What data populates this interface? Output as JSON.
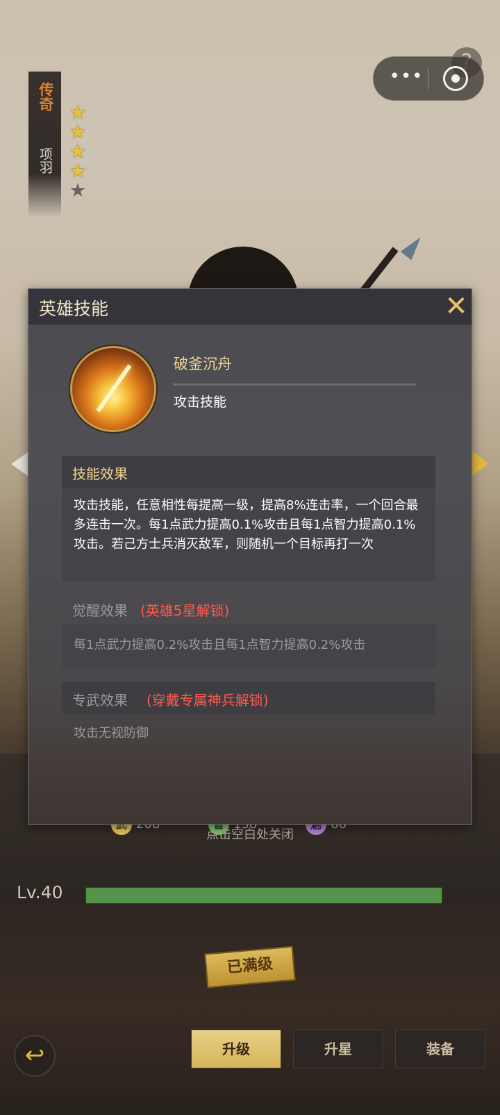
{
  "hero": {
    "rarity": "传奇",
    "name": "项羽",
    "stars_total": 5,
    "stars_filled": 4
  },
  "top_capsule": {
    "more_icon": "more-dots-icon",
    "record_icon": "target-icon",
    "help_icon": "?"
  },
  "modal": {
    "title": "英雄技能",
    "close_icon": "✕",
    "skill": {
      "name": "破釜沉舟",
      "type": "攻击技能"
    },
    "effect": {
      "label": "技能效果",
      "text": "攻击技能，任意相性每提高一级，提高8%连击率，一个回合最多连击一次。每1点武力提高0.1%攻击且每1点智力提高0.1%攻击。若己方士兵消灭敌军，则随机一个目标再打一次"
    },
    "awaken": {
      "label": "觉醒效果",
      "lock_text": "(英雄5星解锁)",
      "text": "每1点武力提高0.2%攻击且每1点智力提高0.2%攻击"
    },
    "exclusive": {
      "label": "专武效果",
      "lock_text": "(穿戴专属神兵解锁)",
      "text": "攻击无视防御"
    }
  },
  "stats": {
    "wu_badge": "武",
    "wu_value": "208",
    "zhi_badge": "智",
    "zhi_value": "158",
    "mei_badge": "魅",
    "mei_value": "66"
  },
  "close_hint": "点击空白处关闭",
  "level": {
    "label": "Lv.40",
    "progress": 1.0,
    "maxed_label": "已满级"
  },
  "bottom_nav": {
    "back_icon": "back-arrow-icon",
    "tabs": [
      "升级",
      "升星",
      "装备"
    ],
    "active_tab": "升级"
  },
  "colors": {
    "accent_gold": "#e5c46a",
    "lock_red": "#ff5a4f",
    "progress_green": "#5a9a4f",
    "rarity_orange": "#e78a3c"
  }
}
